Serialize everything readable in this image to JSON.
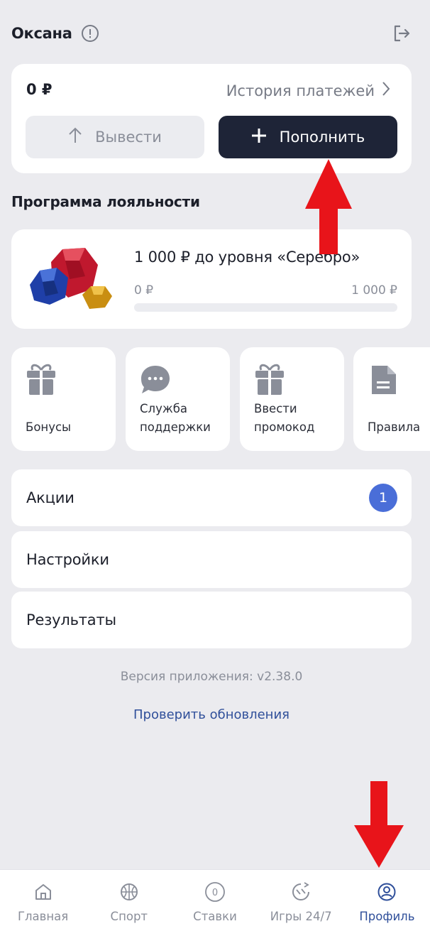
{
  "header": {
    "username": "Оксана",
    "info_icon": "info-circle-icon",
    "logout_icon": "logout-icon"
  },
  "wallet": {
    "balance": "0 ₽",
    "history_label": "История платежей",
    "withdraw_label": "Вывести",
    "deposit_label": "Пополнить"
  },
  "loyalty": {
    "section_title": "Программа лояльности",
    "level_text": "1 000 ₽ до уровня «Серебро»",
    "range_min": "0 ₽",
    "range_max": "1 000 ₽",
    "progress": 0
  },
  "tiles": [
    {
      "label": "Бонусы",
      "icon": "gift-icon"
    },
    {
      "label": "Служба\nподдержки",
      "icon": "chat-bubble-icon"
    },
    {
      "label": "Ввести\nпромокод",
      "icon": "gift-icon"
    },
    {
      "label": "Правила",
      "icon": "document-icon"
    }
  ],
  "menu": {
    "promotions": {
      "label": "Акции",
      "badge": "1"
    },
    "settings": {
      "label": "Настройки"
    },
    "results": {
      "label": "Результаты"
    }
  },
  "footer": {
    "version": "Версия приложения: v2.38.0",
    "check_updates": "Проверить обновления"
  },
  "tabbar": [
    {
      "label": "Главная",
      "icon": "home-icon"
    },
    {
      "label": "Спорт",
      "icon": "basketball-icon"
    },
    {
      "label": "Ставки",
      "icon": "bet-slip-icon",
      "counter": "0"
    },
    {
      "label": "Игры 24/7",
      "icon": "games-247-icon"
    },
    {
      "label": "Профиль",
      "icon": "profile-icon",
      "active": true
    }
  ],
  "colors": {
    "background": "#ebebef",
    "accent_dark": "#1e2437",
    "accent_blue": "#4a6ed8",
    "link_blue": "#2f4f9a",
    "annotation_red": "#e8141a"
  }
}
